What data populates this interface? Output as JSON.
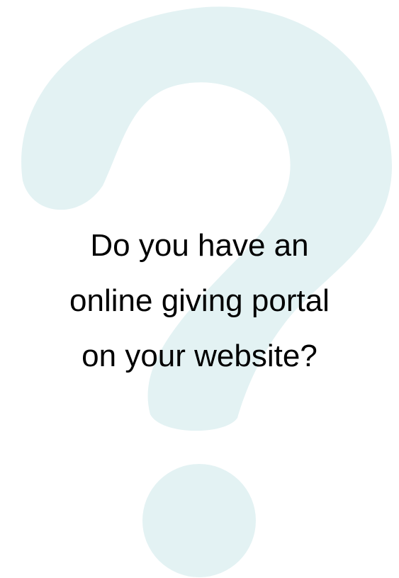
{
  "background": {
    "icon": "question-mark-icon",
    "color": "#e3f2f3",
    "page_color": "#ffffff"
  },
  "question": {
    "line1": "Do you have an",
    "line2": "online giving portal",
    "line3": "on your website?"
  }
}
